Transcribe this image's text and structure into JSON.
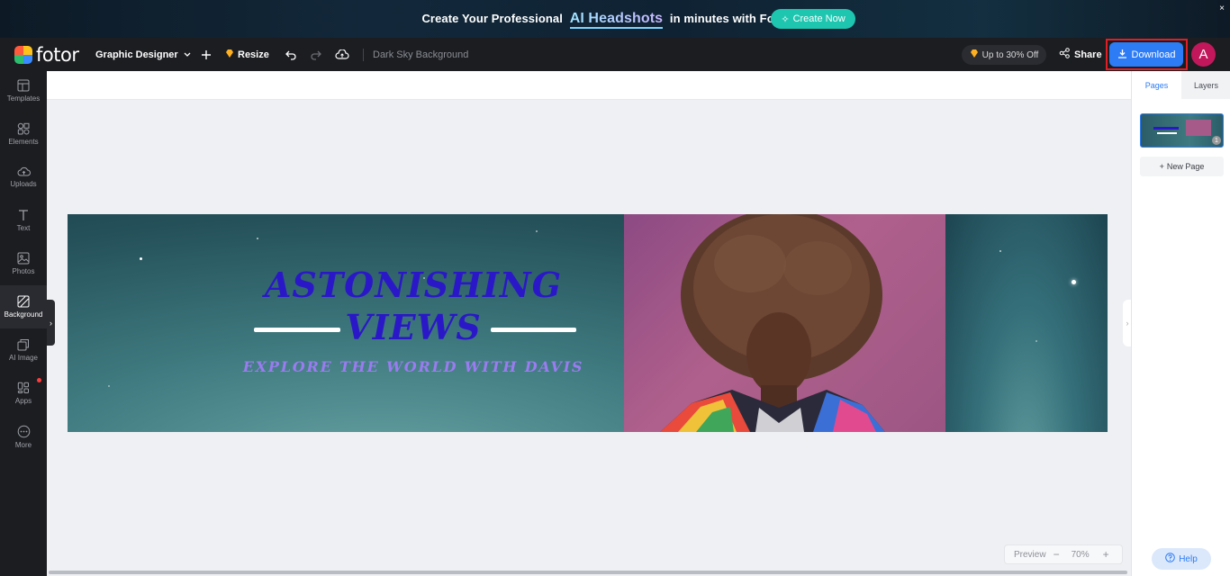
{
  "promo": {
    "text_before": "Create Your Professional",
    "highlight": "AI Headshots",
    "text_after": "in minutes with Fotor AI.",
    "cta": "Create Now",
    "close": "×"
  },
  "topbar": {
    "logo": "fotor",
    "mode": "Graphic Designer",
    "resize": "Resize",
    "doc_title": "Dark Sky Background",
    "offer": "Up to 30% Off",
    "share": "Share",
    "download": "Download",
    "avatar_initial": "A"
  },
  "sidebar": {
    "items": [
      {
        "label": "Templates",
        "icon": "templates-icon"
      },
      {
        "label": "Elements",
        "icon": "elements-icon"
      },
      {
        "label": "Uploads",
        "icon": "uploads-icon"
      },
      {
        "label": "Text",
        "icon": "text-icon"
      },
      {
        "label": "Photos",
        "icon": "photos-icon"
      },
      {
        "label": "Background",
        "icon": "background-icon"
      },
      {
        "label": "AI Image",
        "icon": "ai-image-icon"
      },
      {
        "label": "Apps",
        "icon": "apps-icon"
      },
      {
        "label": "More",
        "icon": "more-icon"
      }
    ],
    "active": "Background"
  },
  "design": {
    "headline_1": "ASTONISHING",
    "headline_2": "VIEWS",
    "tagline": "EXPLORE THE WORLD WITH DAVIS"
  },
  "zoom": {
    "preview": "Preview",
    "minus": "−",
    "level": "70%",
    "plus": "+"
  },
  "right_panel": {
    "tabs": [
      "Pages",
      "Layers"
    ],
    "active_tab": "Pages",
    "page_number": "1",
    "new_page": "New Page",
    "help": "Help"
  },
  "colors": {
    "accent": "#2d7cf6",
    "headline": "#2a18c8",
    "tagline": "#9a7cf0",
    "highlight_frame": "#e01e26"
  }
}
